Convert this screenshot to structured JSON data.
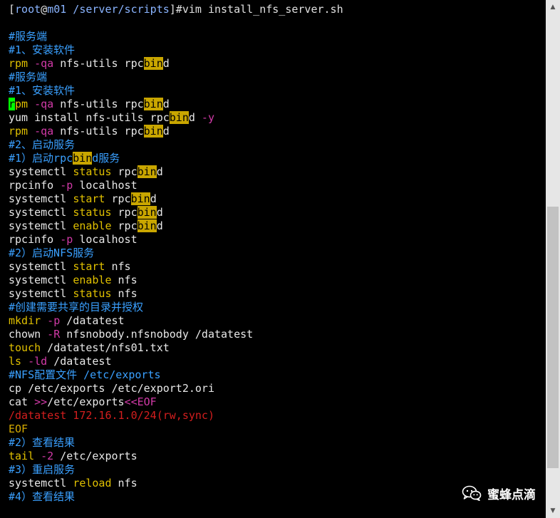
{
  "colors": {
    "prompt_bracket": "#e0e0e0",
    "prompt_user": "#8ab4ff",
    "prompt_host": "#8ab4ff",
    "prompt_path": "#8ab4ff",
    "comment": "#3aa0ff",
    "command": "#e8e8e8",
    "keyword": "#e0c000",
    "option": "#d23aa8",
    "string_red": "#d41e1e",
    "heredoc_eof": "#d4aa00",
    "highlight_bg": "#c9a600",
    "cursor_bg": "#00ff00"
  },
  "terminal": {
    "lines": [
      {
        "segments": [
          {
            "text": "[",
            "c": "prompt_bracket"
          },
          {
            "text": "root",
            "c": "prompt_user"
          },
          {
            "text": "@",
            "c": "prompt_bracket"
          },
          {
            "text": "m01",
            "c": "prompt_host"
          },
          {
            "text": " /server/scripts",
            "c": "prompt_path"
          },
          {
            "text": "]#vim install_nfs_server.sh",
            "c": "prompt_bracket"
          }
        ]
      },
      {
        "segments": []
      },
      {
        "segments": [
          {
            "text": "#服务端",
            "c": "comment"
          }
        ]
      },
      {
        "segments": [
          {
            "text": "#1、安装软件",
            "c": "comment"
          }
        ]
      },
      {
        "segments": [
          {
            "text": "rpm",
            "c": "keyword"
          },
          {
            "text": " -qa",
            "c": "option"
          },
          {
            "text": " nfs-utils rpc",
            "c": "command"
          },
          {
            "text": "bin",
            "c": "command",
            "hl": true
          },
          {
            "text": "d",
            "c": "command"
          }
        ]
      },
      {
        "segments": [
          {
            "text": "#服务端",
            "c": "comment"
          }
        ]
      },
      {
        "segments": [
          {
            "text": "#1、安装软件",
            "c": "comment"
          }
        ]
      },
      {
        "segments": [
          {
            "text": "r",
            "c": "command",
            "cursor": true
          },
          {
            "text": "pm",
            "c": "keyword"
          },
          {
            "text": " -qa",
            "c": "option"
          },
          {
            "text": " nfs-utils rpc",
            "c": "command"
          },
          {
            "text": "bin",
            "c": "command",
            "hl": true
          },
          {
            "text": "d",
            "c": "command"
          }
        ]
      },
      {
        "segments": [
          {
            "text": "yum install nfs-utils rpc",
            "c": "command"
          },
          {
            "text": "bin",
            "c": "command",
            "hl": true
          },
          {
            "text": "d",
            "c": "command"
          },
          {
            "text": " -y",
            "c": "option"
          }
        ]
      },
      {
        "segments": [
          {
            "text": "rpm",
            "c": "keyword"
          },
          {
            "text": " -qa",
            "c": "option"
          },
          {
            "text": " nfs-utils rpc",
            "c": "command"
          },
          {
            "text": "bin",
            "c": "command",
            "hl": true
          },
          {
            "text": "d",
            "c": "command"
          }
        ]
      },
      {
        "segments": [
          {
            "text": "#2、启动服务",
            "c": "comment"
          }
        ]
      },
      {
        "segments": [
          {
            "text": "#1）启动rpc",
            "c": "comment"
          },
          {
            "text": "bin",
            "c": "comment",
            "hl": true
          },
          {
            "text": "d服务",
            "c": "comment"
          }
        ]
      },
      {
        "segments": [
          {
            "text": "systemctl ",
            "c": "command"
          },
          {
            "text": "status",
            "c": "keyword"
          },
          {
            "text": " rpc",
            "c": "command"
          },
          {
            "text": "bin",
            "c": "command",
            "hl": true
          },
          {
            "text": "d",
            "c": "command"
          }
        ]
      },
      {
        "segments": [
          {
            "text": "rpcinfo",
            "c": "command"
          },
          {
            "text": " -p",
            "c": "option"
          },
          {
            "text": " localhost",
            "c": "command"
          }
        ]
      },
      {
        "segments": [
          {
            "text": "systemctl ",
            "c": "command"
          },
          {
            "text": "start",
            "c": "keyword"
          },
          {
            "text": " rpc",
            "c": "command"
          },
          {
            "text": "bin",
            "c": "command",
            "hl": true
          },
          {
            "text": "d",
            "c": "command"
          }
        ]
      },
      {
        "segments": [
          {
            "text": "systemctl ",
            "c": "command"
          },
          {
            "text": "status",
            "c": "keyword"
          },
          {
            "text": " rpc",
            "c": "command"
          },
          {
            "text": "bin",
            "c": "command",
            "hl": true
          },
          {
            "text": "d",
            "c": "command"
          }
        ]
      },
      {
        "segments": [
          {
            "text": "systemctl ",
            "c": "command"
          },
          {
            "text": "enable",
            "c": "keyword"
          },
          {
            "text": " rpc",
            "c": "command"
          },
          {
            "text": "bin",
            "c": "command",
            "hl": true
          },
          {
            "text": "d",
            "c": "command"
          }
        ]
      },
      {
        "segments": [
          {
            "text": "rpcinfo",
            "c": "command"
          },
          {
            "text": " -p",
            "c": "option"
          },
          {
            "text": " localhost",
            "c": "command"
          }
        ]
      },
      {
        "segments": [
          {
            "text": "#2）启动NFS服务",
            "c": "comment"
          }
        ]
      },
      {
        "segments": [
          {
            "text": "systemctl ",
            "c": "command"
          },
          {
            "text": "start",
            "c": "keyword"
          },
          {
            "text": " nfs",
            "c": "command"
          }
        ]
      },
      {
        "segments": [
          {
            "text": "systemctl ",
            "c": "command"
          },
          {
            "text": "enable",
            "c": "keyword"
          },
          {
            "text": " nfs",
            "c": "command"
          }
        ]
      },
      {
        "segments": [
          {
            "text": "systemctl ",
            "c": "command"
          },
          {
            "text": "status",
            "c": "keyword"
          },
          {
            "text": " nfs",
            "c": "command"
          }
        ]
      },
      {
        "segments": [
          {
            "text": "#创建需要共享的目录并授权",
            "c": "comment"
          }
        ]
      },
      {
        "segments": [
          {
            "text": "mkdir",
            "c": "keyword"
          },
          {
            "text": " -p",
            "c": "option"
          },
          {
            "text": " /datatest",
            "c": "command"
          }
        ]
      },
      {
        "segments": [
          {
            "text": "chown",
            "c": "command"
          },
          {
            "text": " -R",
            "c": "option"
          },
          {
            "text": " nfsnobody.nfsnobody /datatest",
            "c": "command"
          }
        ]
      },
      {
        "segments": [
          {
            "text": "touch",
            "c": "keyword"
          },
          {
            "text": " /datatest/nfs01.txt",
            "c": "command"
          }
        ]
      },
      {
        "segments": [
          {
            "text": "ls",
            "c": "keyword"
          },
          {
            "text": " -ld",
            "c": "option"
          },
          {
            "text": " /datatest",
            "c": "command"
          }
        ]
      },
      {
        "segments": [
          {
            "text": "#NFS配置文件 /etc/exports",
            "c": "comment"
          }
        ]
      },
      {
        "segments": [
          {
            "text": "cp /etc/exports /etc/export2.ori",
            "c": "command"
          }
        ]
      },
      {
        "segments": [
          {
            "text": "cat ",
            "c": "command"
          },
          {
            "text": ">>",
            "c": "option"
          },
          {
            "text": "/etc/exports",
            "c": "command"
          },
          {
            "text": "<<EOF",
            "c": "option"
          }
        ]
      },
      {
        "segments": [
          {
            "text": "/datatest 172.16.1.0/24(rw,sync)",
            "c": "string_red"
          }
        ]
      },
      {
        "segments": [
          {
            "text": "EOF",
            "c": "heredoc_eof"
          }
        ]
      },
      {
        "segments": [
          {
            "text": "#2）查看结果",
            "c": "comment"
          }
        ]
      },
      {
        "segments": [
          {
            "text": "tail",
            "c": "keyword"
          },
          {
            "text": " -2",
            "c": "option"
          },
          {
            "text": " /etc/exports",
            "c": "command"
          }
        ]
      },
      {
        "segments": [
          {
            "text": "#3）重启服务",
            "c": "comment"
          }
        ]
      },
      {
        "segments": [
          {
            "text": "systemctl ",
            "c": "command"
          },
          {
            "text": "reload",
            "c": "keyword"
          },
          {
            "text": " nfs",
            "c": "command"
          }
        ]
      },
      {
        "segments": [
          {
            "text": "#4）查看结果",
            "c": "comment"
          }
        ]
      }
    ]
  },
  "scrollbar": {
    "up_icon": "triangle-up-icon",
    "down_icon": "triangle-down-icon"
  },
  "watermark": {
    "label": "蜜蜂点滴",
    "icon": "wechat-icon"
  }
}
